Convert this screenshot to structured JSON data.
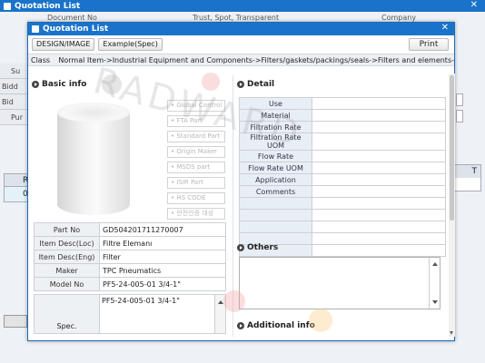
{
  "bg_window": {
    "title": "Quotation List",
    "headers": [
      "Document No",
      "Trust, Spot, Transparent",
      "Company"
    ],
    "row_labels": [
      "Su",
      "Bidd",
      "Bid",
      "Pur"
    ],
    "grid_header": "R",
    "grid_cell": "0",
    "right_header": "T"
  },
  "modal": {
    "title": "Quotation List",
    "tabs": [
      "DESIGN/IMAGE",
      "Example(Spec)"
    ],
    "print_label": "Print",
    "class_label": "Class",
    "class_value": "Normal Item->Industrial Equipment and Components->Filters/gaskets/packings/seals->Filters and elements-"
  },
  "basic_info": {
    "title": "Basic info",
    "side_buttons": [
      "Global Control",
      "FTA Part",
      "Standard Part",
      "Origin Maker",
      "MSDS part",
      "ISIR Part",
      "HS CODE",
      "안전인증 대상"
    ],
    "fields": [
      {
        "label": "Part No",
        "value": "GD504201711270007"
      },
      {
        "label": "Item Desc(Loc)",
        "value": "Filtre Elemanı"
      },
      {
        "label": "Item Desc(Eng)",
        "value": "Filter"
      },
      {
        "label": "Maker",
        "value": "TPC Pneumatics"
      },
      {
        "label": "Model No",
        "value": "PF5-24-005-01  3/4-1\""
      }
    ],
    "spec_label": "Spec.",
    "spec_value": "PF5-24-005-01  3/4-1\""
  },
  "detail": {
    "title": "Detail",
    "rows": [
      "Use",
      "Material",
      "Filtration Rate",
      "Filtration Rate UOM",
      "Flow Rate",
      "Flow Rate UOM",
      "Application",
      "Comments",
      "",
      "",
      "",
      "",
      ""
    ]
  },
  "others": {
    "title": "Others"
  },
  "additional": {
    "title": "Additional info"
  },
  "watermark": {
    "text": "RADWARD"
  },
  "colors": {
    "title_bar": "#1a73c9",
    "label_bg": "#eef1f4",
    "detail_label_bg": "#e8eef6"
  }
}
